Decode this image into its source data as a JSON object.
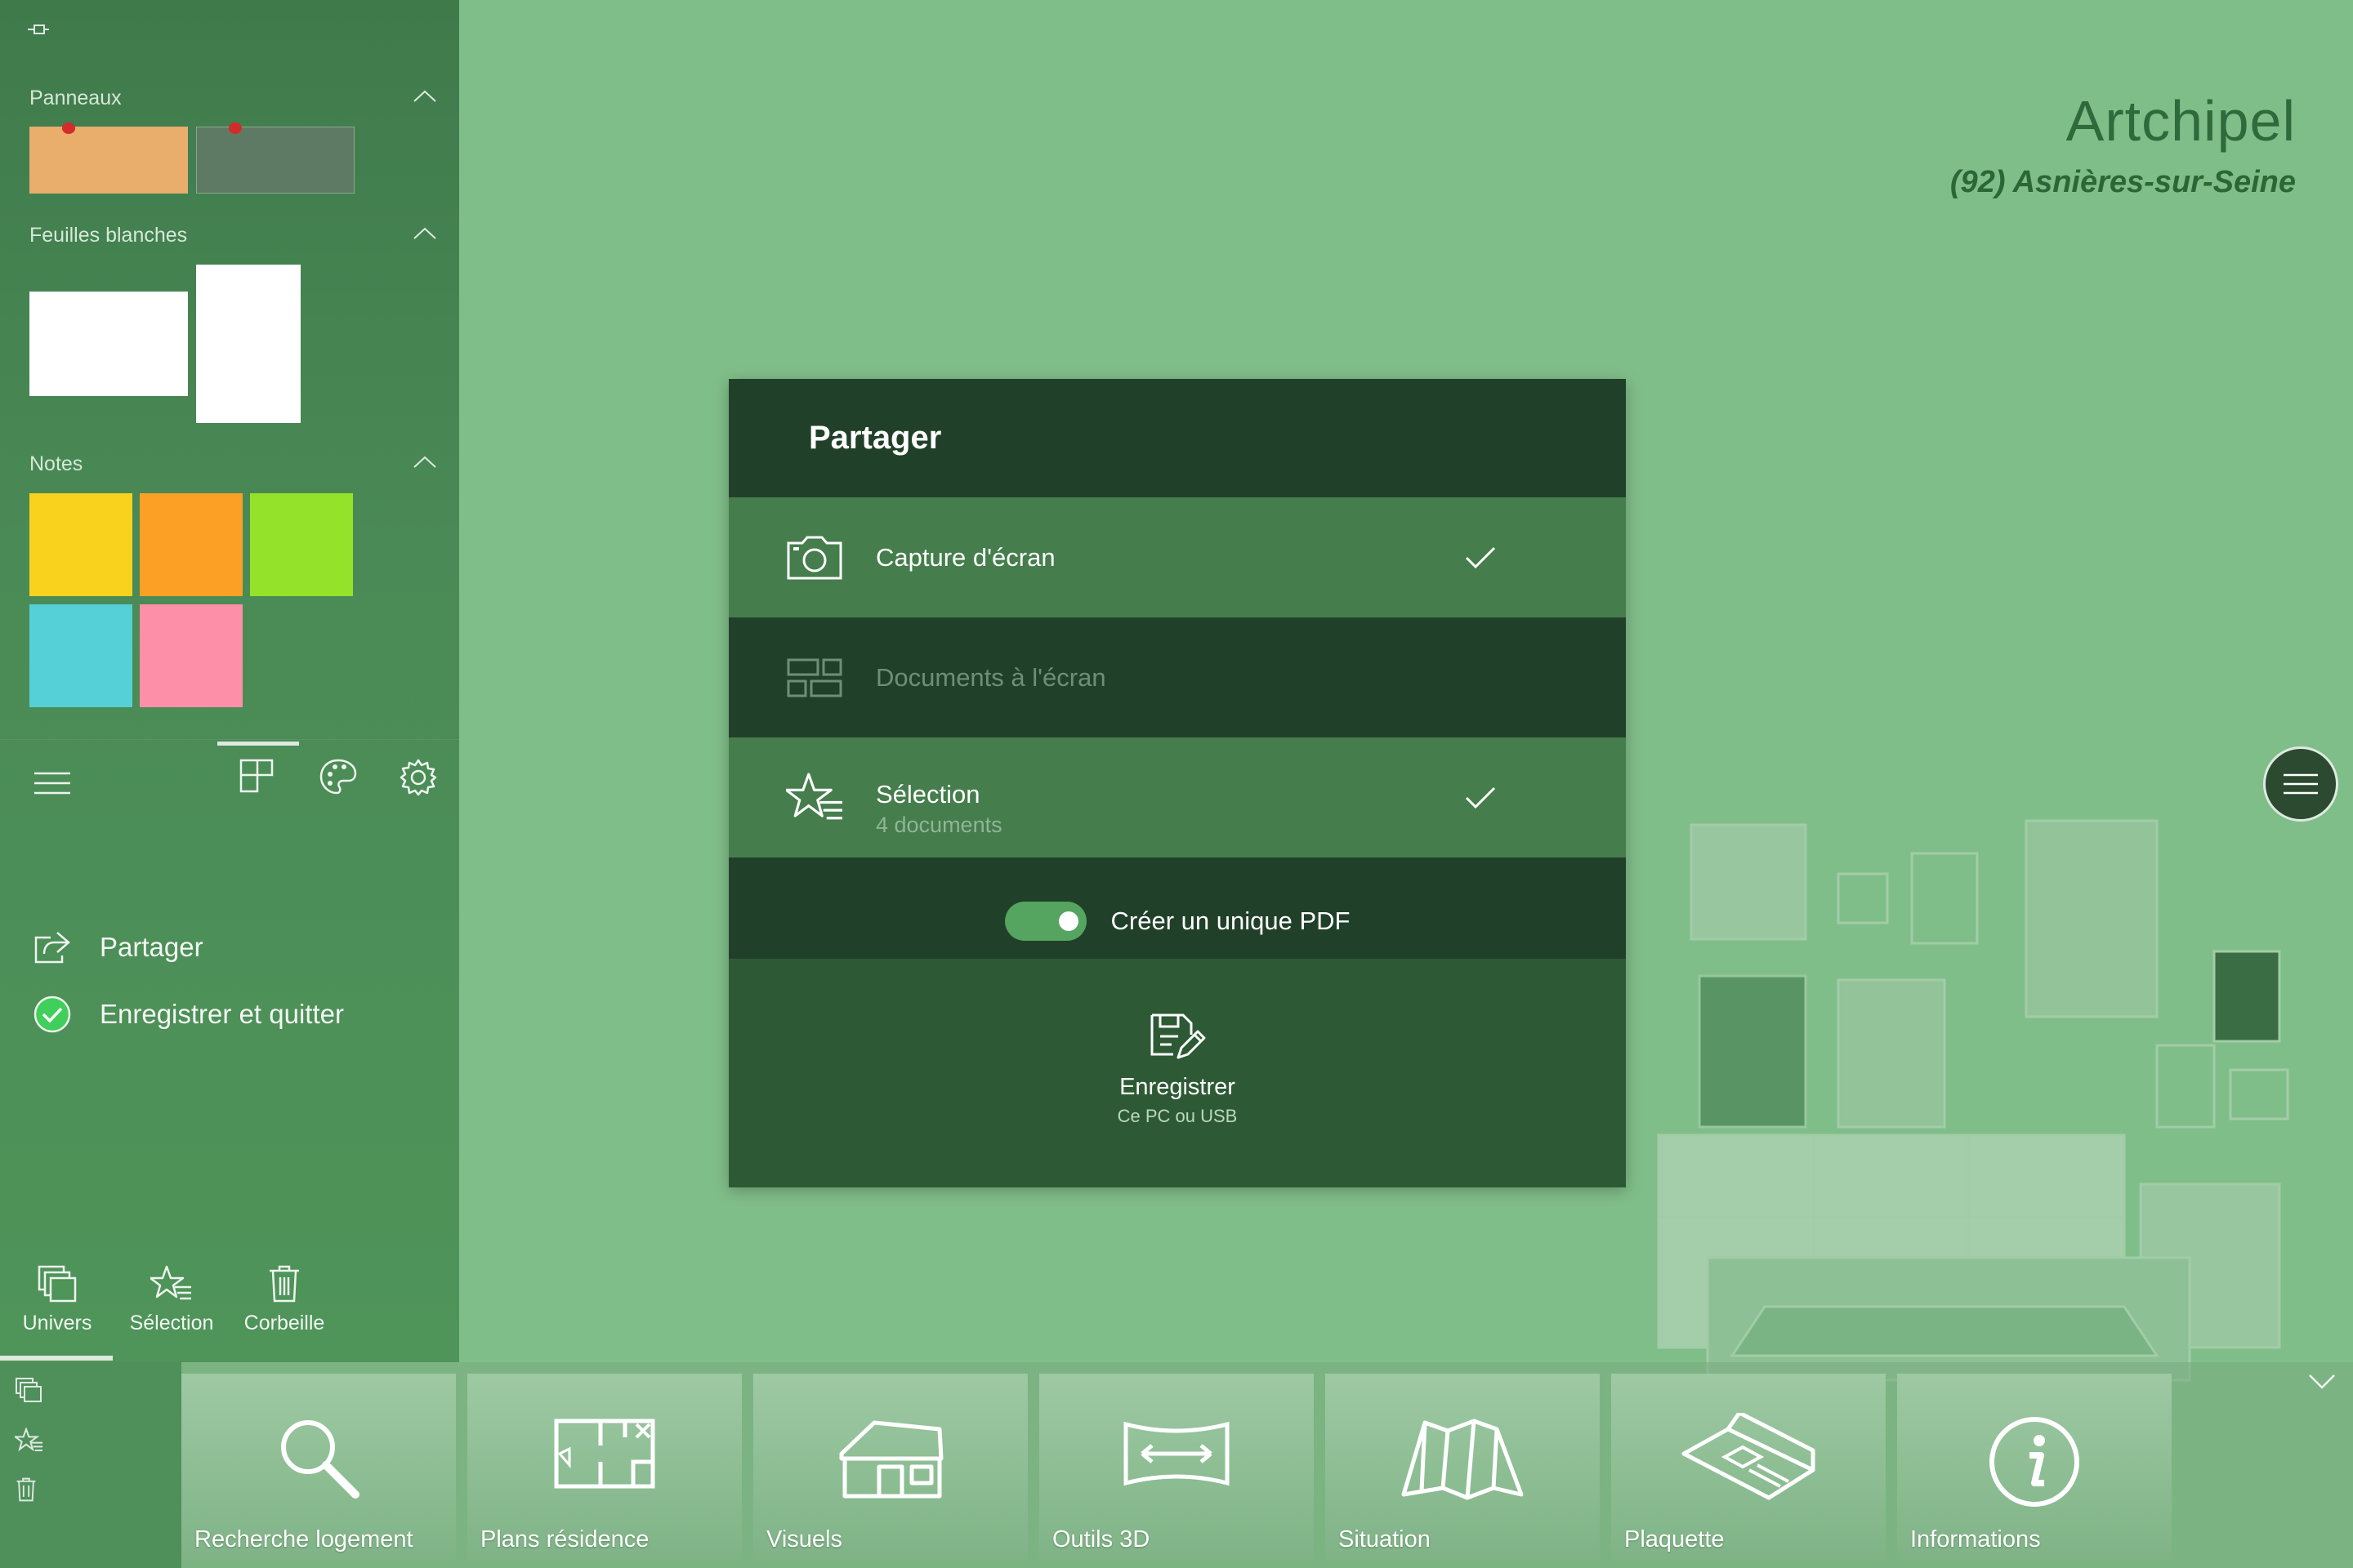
{
  "brand": {
    "title": "Artchipel",
    "city": "(92) Asnières-sur-Seine"
  },
  "sidebar": {
    "sections": [
      {
        "label": "Panneaux"
      },
      {
        "label": "Feuilles blanches"
      },
      {
        "label": "Notes"
      }
    ],
    "note_colors": [
      "#f9d21e",
      "#fba024",
      "#94e22a",
      "#55d0d6",
      "#fd8fa8"
    ],
    "panel_colors": [
      "#e9ad6c",
      "#5f7a64"
    ],
    "menu": [
      {
        "label": "Partager",
        "icon": "share-icon"
      },
      {
        "label": "Enregistrer et quitter",
        "icon": "check-circle-icon"
      }
    ],
    "bottom": [
      {
        "label": "Univers",
        "icon": "layers-icon"
      },
      {
        "label": "Sélection",
        "icon": "star-list-icon"
      },
      {
        "label": "Corbeille",
        "icon": "trash-icon"
      }
    ]
  },
  "dialog": {
    "title": "Partager",
    "options": [
      {
        "title": "Capture d'écran",
        "subtitle": "",
        "checked": true,
        "icon": "camera-icon"
      },
      {
        "title": "Documents à l'écran",
        "subtitle": "",
        "checked": false,
        "icon": "grid-icon"
      },
      {
        "title": "Sélection",
        "subtitle": "4 documents",
        "checked": true,
        "icon": "star-list-icon"
      }
    ],
    "pdf_toggle": {
      "label": "Créer un unique PDF",
      "on": true
    },
    "save": {
      "label": "Enregistrer",
      "sublabel": "Ce PC ou USB",
      "icon": "save-icon"
    }
  },
  "nav": [
    {
      "label": "Recherche logement",
      "icon": "magnifier-icon"
    },
    {
      "label": "Plans résidence",
      "icon": "floorplan-icon"
    },
    {
      "label": "Visuels",
      "icon": "house-icon"
    },
    {
      "label": "Outils 3D",
      "icon": "panorama-icon"
    },
    {
      "label": "Situation",
      "icon": "map-icon"
    },
    {
      "label": "Plaquette",
      "icon": "brochure-icon"
    },
    {
      "label": "Informations",
      "icon": "info-icon"
    }
  ],
  "colors": {
    "background": "#80be89",
    "dialog_dark": "#21402a",
    "dialog_selected": "#457d4c",
    "brand_text": "#2e6a3c"
  }
}
